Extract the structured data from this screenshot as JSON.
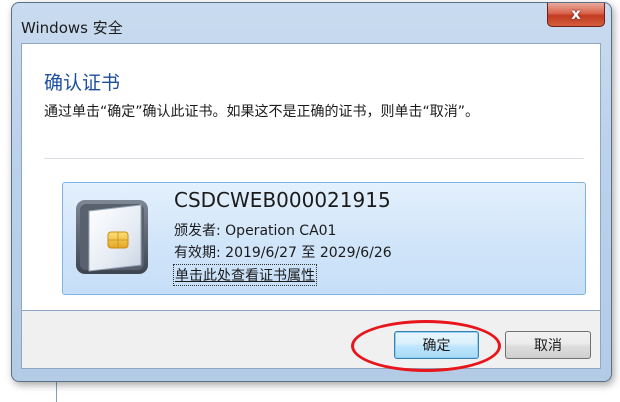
{
  "window": {
    "title": "Windows 安全",
    "close_label": "x"
  },
  "dialog": {
    "heading": "确认证书",
    "message": "通过单击“确定”确认此证书。如果这不是正确的证书，则单击“取消”。"
  },
  "certificate": {
    "name": "CSDCWEB000021915",
    "issuer": "颁发者: Operation CA01",
    "validity": "有效期: 2019/6/27 至 2029/6/26",
    "details_link": "单击此处查看证书属性"
  },
  "buttons": {
    "ok_label": "确定",
    "cancel_label": "取消"
  },
  "annotation": {
    "highlight_color": "#e8151b",
    "highlighted_target": "ok-button"
  },
  "icons": {
    "close": "close-icon",
    "certificate": "certificate-card-icon"
  }
}
